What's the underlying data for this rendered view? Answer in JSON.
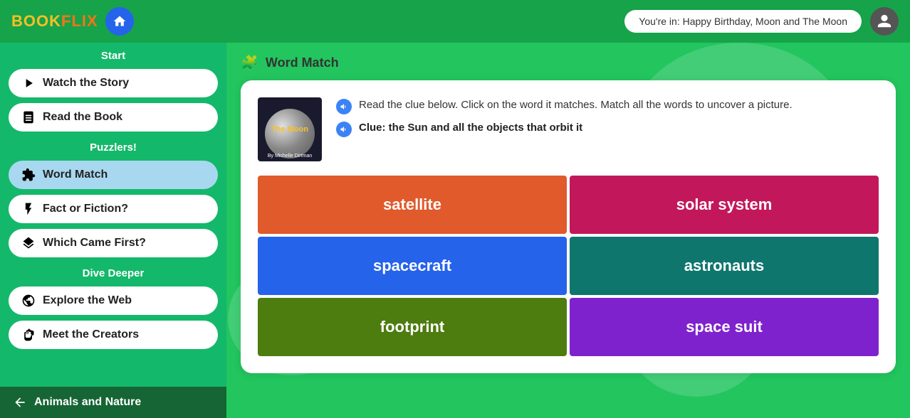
{
  "header": {
    "logo": "BOOKFLIX",
    "logo_book": "BOOK",
    "logo_flix": "FLIX",
    "home_label": "Home",
    "you_are_in": "You're in: Happy Birthday, Moon and The Moon",
    "user_label": "User Profile"
  },
  "sidebar": {
    "start_label": "Start",
    "puzzlers_label": "Puzzlers!",
    "dive_deeper_label": "Dive Deeper",
    "items": [
      {
        "id": "watch-story",
        "label": "Watch the Story",
        "icon": "play"
      },
      {
        "id": "read-book",
        "label": "Read the Book",
        "icon": "book"
      },
      {
        "id": "word-match",
        "label": "Word Match",
        "icon": "puzzle",
        "active": true
      },
      {
        "id": "fact-fiction",
        "label": "Fact or Fiction?",
        "icon": "lightning"
      },
      {
        "id": "which-came-first",
        "label": "Which Came First?",
        "icon": "layers"
      },
      {
        "id": "explore-web",
        "label": "Explore the Web",
        "icon": "globe"
      },
      {
        "id": "meet-creators",
        "label": "Meet the Creators",
        "icon": "hand"
      }
    ],
    "footer": {
      "label": "Animals and Nature",
      "icon": "arrow-left"
    }
  },
  "main": {
    "page_title": "Word Match",
    "page_title_icon": "🧩",
    "card": {
      "book_title": "The Moon",
      "book_author": "By Michelle Dirtman",
      "instructions": [
        "Read the clue below. Click on the word it matches. Match all the words to uncover a picture.",
        "Clue: the Sun and all the objects that orbit it"
      ],
      "clue_label": "Clue: ",
      "clue_text": "the Sun and all the objects that orbit it"
    },
    "words": [
      {
        "id": "satellite",
        "label": "satellite",
        "color": "#e05a2b"
      },
      {
        "id": "solar-system",
        "label": "solar system",
        "color": "#c2185b"
      },
      {
        "id": "spacecraft",
        "label": "spacecraft",
        "color": "#2563eb"
      },
      {
        "id": "astronauts",
        "label": "astronauts",
        "color": "#0f766e"
      },
      {
        "id": "footprint",
        "label": "footprint",
        "color": "#4d7c0f"
      },
      {
        "id": "space-suit",
        "label": "space suit",
        "color": "#7e22ce"
      }
    ]
  }
}
